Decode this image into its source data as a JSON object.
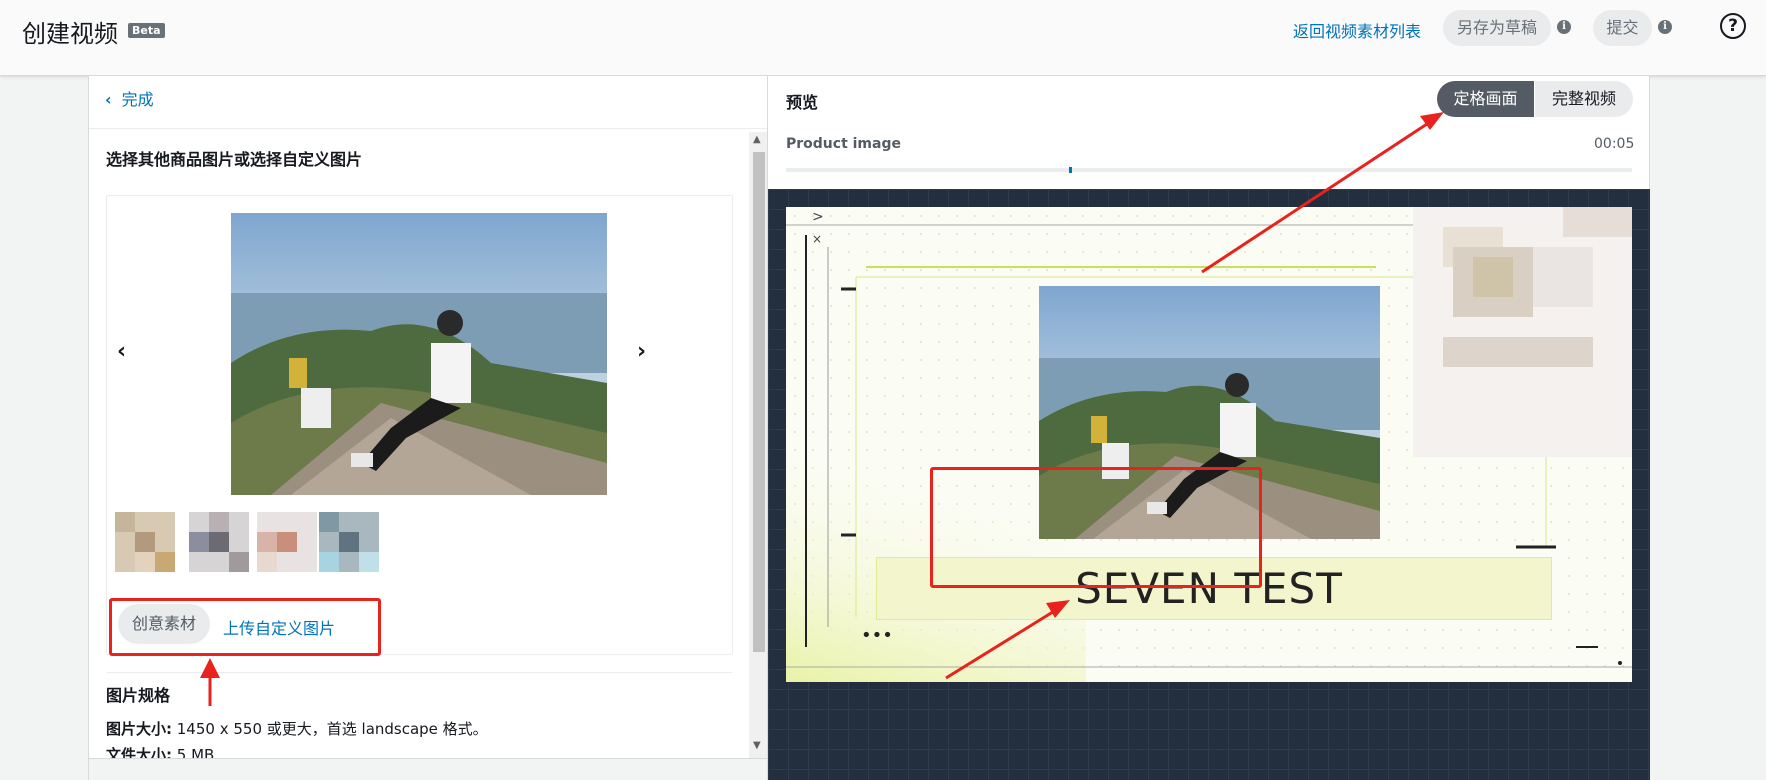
{
  "topbar": {
    "title": "创建视频",
    "beta": "Beta",
    "back_link": "返回视频素材列表",
    "save_draft": "另存为草稿",
    "submit": "提交",
    "info_glyph": "i",
    "help_glyph": "?"
  },
  "left": {
    "done": "完成",
    "section_title": "选择其他商品图片或选择自定义图片",
    "creative_button": "创意素材",
    "upload_link": "上传自定义图片",
    "spec_title": "图片规格",
    "spec_size_label": "图片大小:",
    "spec_size_value": " 1450 x 550 或更大，首选 landscape 格式。",
    "spec_file_label": "文件大小:",
    "spec_file_value": " 5 MB"
  },
  "right": {
    "preview": "预览",
    "tab_freeze": "定格画面",
    "tab_full": "完整视频",
    "product_image": "Product image",
    "time": "00:05",
    "progress_fraction": 0.335,
    "headline": "SEVEN TEST"
  },
  "colors": {
    "link": "#0073bb",
    "annotation_red": "#e8221c",
    "active_tab": "#545b64"
  },
  "icons": [
    "chevron-left-icon",
    "chevron-right-icon",
    "info-icon",
    "help-icon",
    "more-icon"
  ]
}
